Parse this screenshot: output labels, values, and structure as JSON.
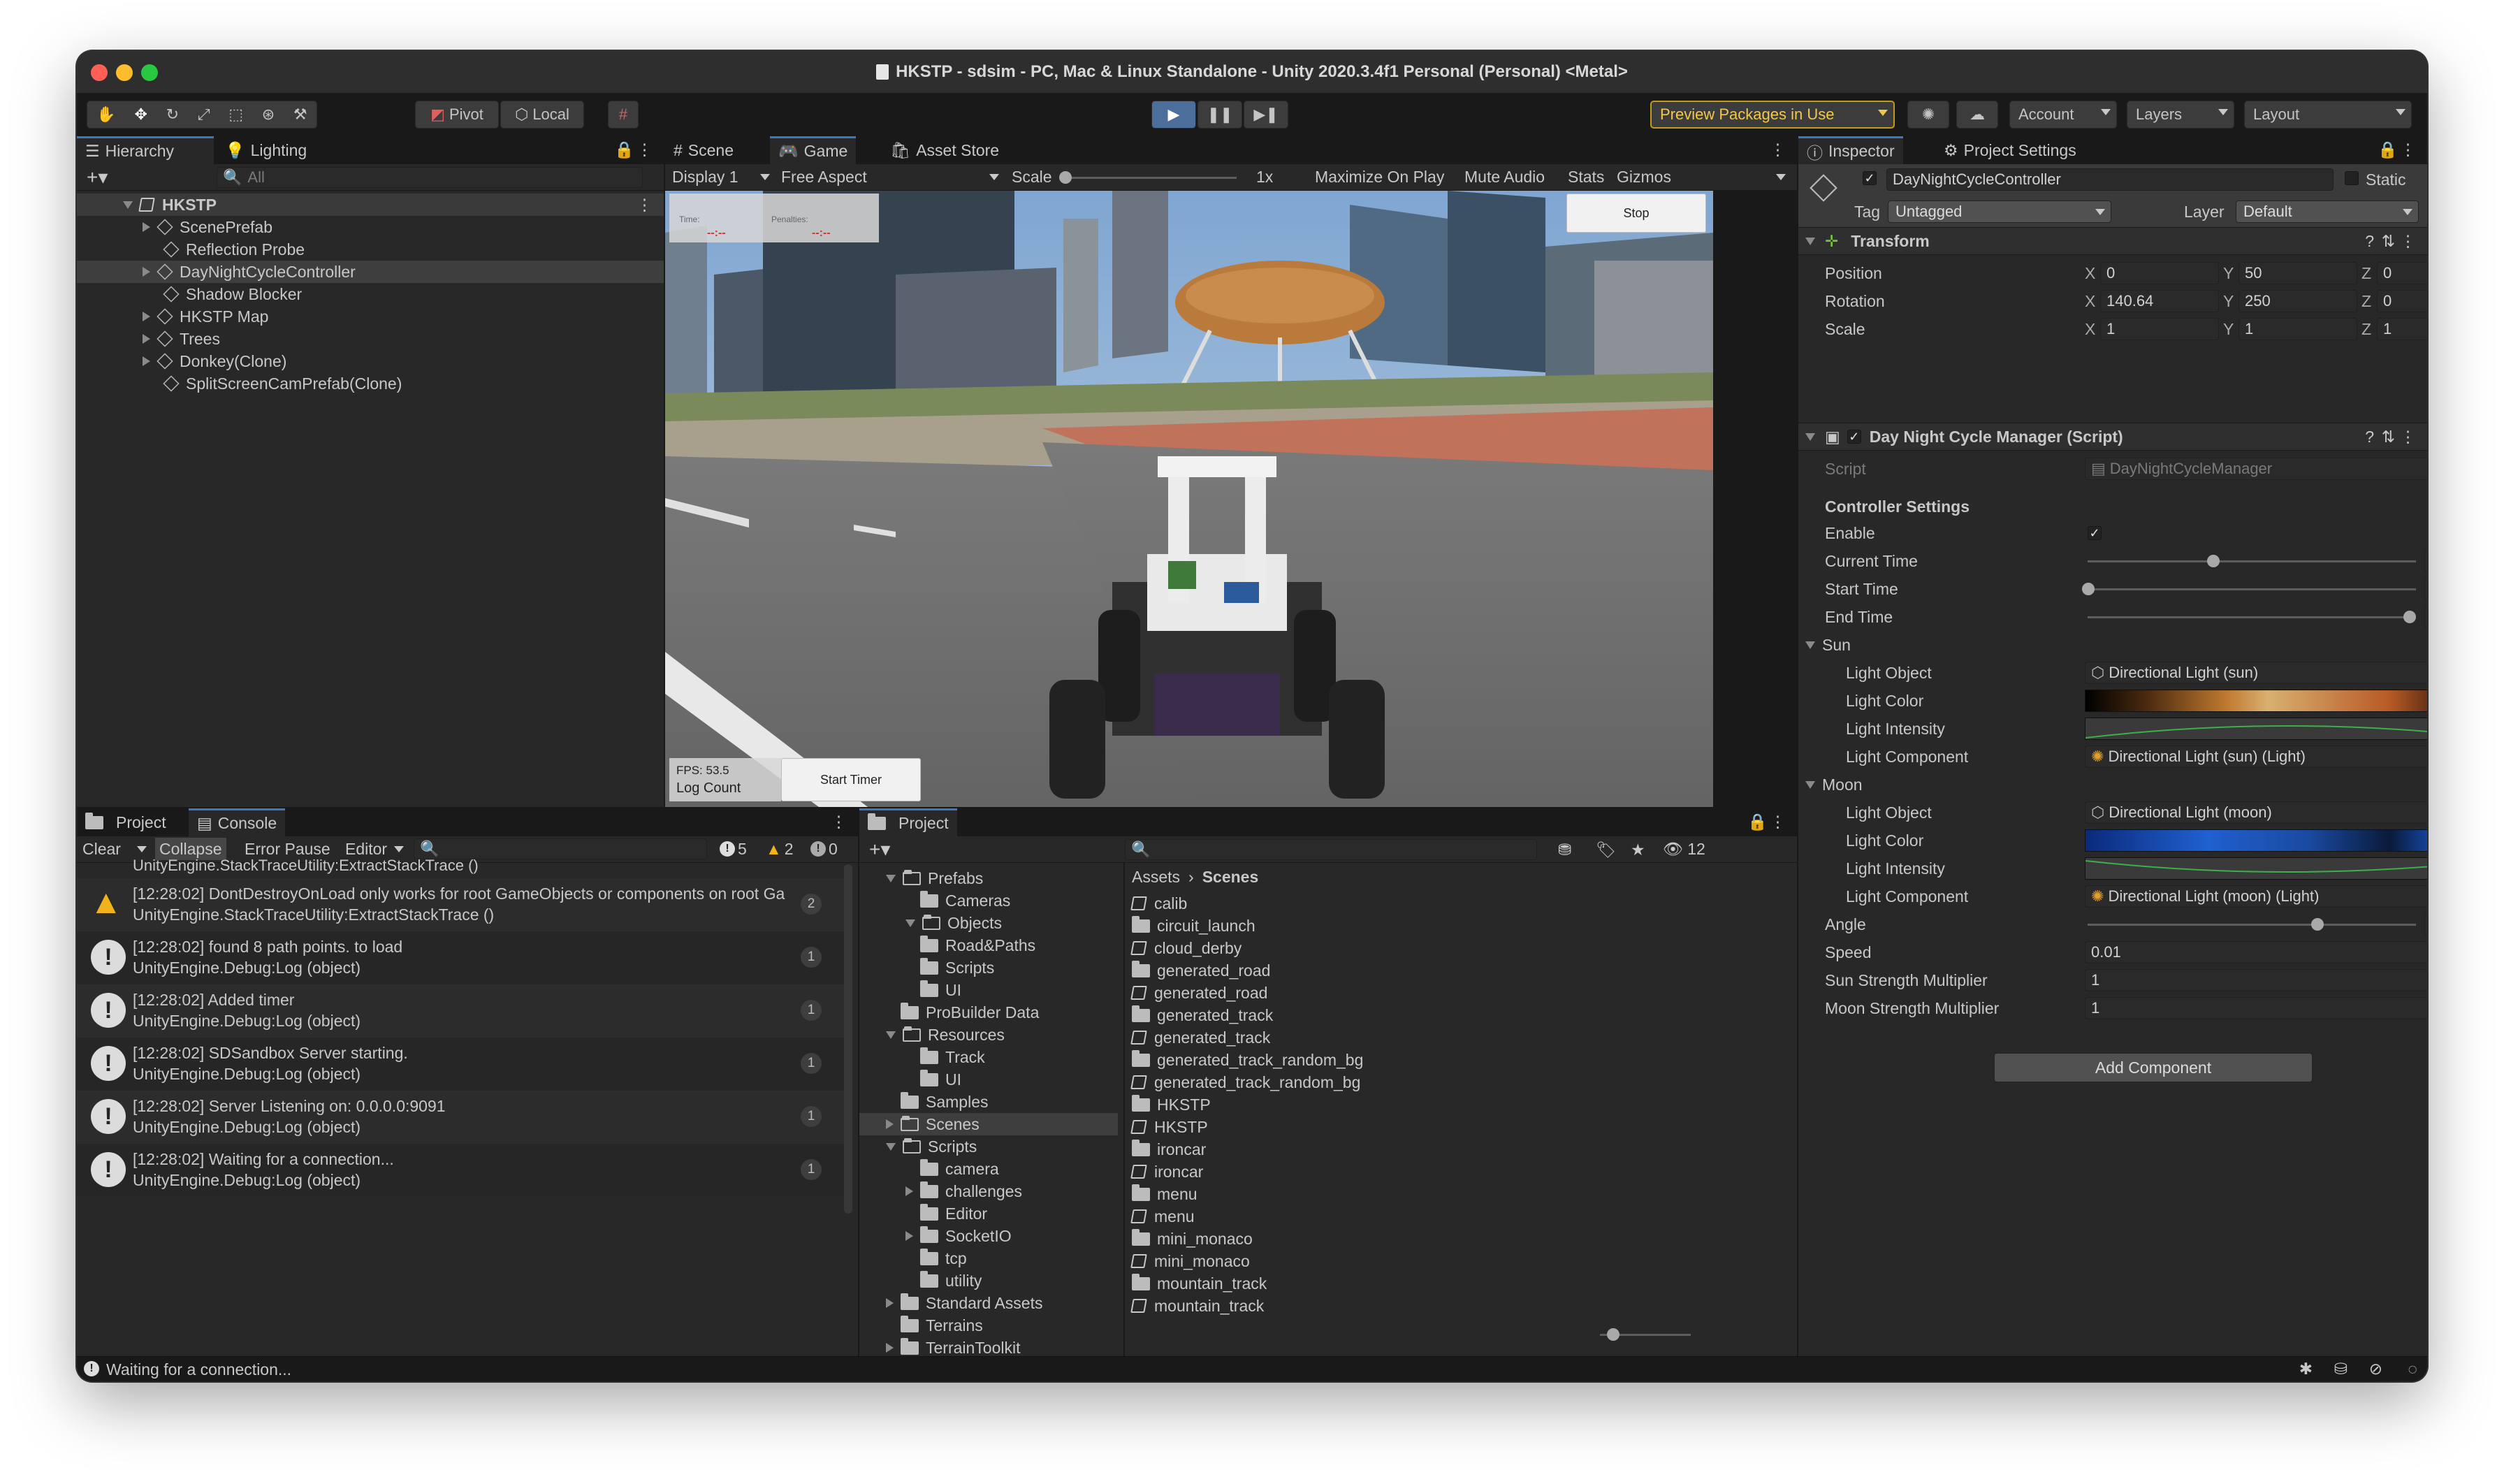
{
  "window": {
    "title": "HKSTP - sdsim - PC, Mac & Linux Standalone - Unity 2020.3.4f1 Personal (Personal) <Metal>"
  },
  "toolbar": {
    "pivot": "Pivot",
    "local": "Local",
    "preview_packages": "Preview Packages in Use",
    "account": "Account",
    "layers": "Layers",
    "layout": "Layout"
  },
  "hierarchy": {
    "tab": "Hierarchy",
    "lighting_tab": "Lighting",
    "search_placeholder": "All",
    "root": "HKSTP",
    "items": [
      "ScenePrefab",
      "Reflection Probe",
      "DayNightCycleController",
      "Shadow Blocker",
      "HKSTP Map",
      "Trees",
      "Donkey(Clone)",
      "SplitScreenCamPrefab(Clone)"
    ]
  },
  "gameview": {
    "tabs": [
      "Scene",
      "Game",
      "Asset Store"
    ],
    "display": "Display 1",
    "aspect": "Free Aspect",
    "scale_label": "Scale",
    "scale_value": "1x",
    "buttons": [
      "Maximize On Play",
      "Mute Audio",
      "Stats",
      "Gizmos"
    ],
    "overlay": {
      "time_label": "Time:",
      "time_value": "--:--",
      "penalties_label": "Penalties:",
      "penalties_value": "--:--",
      "stop": "Stop",
      "fps": "FPS: 53.5",
      "log_count": "Log Count",
      "start_timer": "Start Timer"
    }
  },
  "console": {
    "project_tab": "Project",
    "tab": "Console",
    "clear": "Clear",
    "collapse": "Collapse",
    "error_pause": "Error Pause",
    "editor": "Editor",
    "count_info": "5",
    "count_warn": "2",
    "count_err": "0",
    "cut_line": "UnityEngine.StackTraceUtility:ExtractStackTrace ()",
    "entries": [
      {
        "type": "warn",
        "l1": "[12:28:02] DontDestroyOnLoad only works for root GameObjects or components on root Ga",
        "l2": "UnityEngine.StackTraceUtility:ExtractStackTrace ()",
        "count": "2"
      },
      {
        "type": "info",
        "l1": "[12:28:02] found 8 path points. to load",
        "l2": "UnityEngine.Debug:Log (object)",
        "count": "1"
      },
      {
        "type": "info",
        "l1": "[12:28:02] Added timer",
        "l2": "UnityEngine.Debug:Log (object)",
        "count": "1"
      },
      {
        "type": "info",
        "l1": "[12:28:02] SDSandbox Server starting.",
        "l2": "UnityEngine.Debug:Log (object)",
        "count": "1"
      },
      {
        "type": "info",
        "l1": "[12:28:02] Server Listening on: 0.0.0.0:9091",
        "l2": "UnityEngine.Debug:Log (object)",
        "count": "1"
      },
      {
        "type": "info",
        "l1": "[12:28:02] Waiting for a connection...",
        "l2": "UnityEngine.Debug:Log (object)",
        "count": "1"
      }
    ]
  },
  "project": {
    "tab": "Project",
    "hidden_count": "12",
    "breadcrumb_root": "Assets",
    "breadcrumb_current": "Scenes",
    "tree": [
      "Prefabs",
      "Cameras",
      "Objects",
      "Road&Paths",
      "Scripts",
      "UI",
      "ProBuilder Data",
      "Resources",
      "Track",
      "UI",
      "Samples",
      "Scenes",
      "Scripts",
      "camera",
      "challenges",
      "Editor",
      "SocketIO",
      "tcp",
      "utility",
      "Standard Assets",
      "Terrains",
      "TerrainToolkit"
    ],
    "files": [
      {
        "name": "calib",
        "scene": true
      },
      {
        "name": "circuit_launch",
        "scene": false
      },
      {
        "name": "cloud_derby",
        "scene": true
      },
      {
        "name": "generated_road",
        "scene": false
      },
      {
        "name": "generated_road",
        "scene": true
      },
      {
        "name": "generated_track",
        "scene": false
      },
      {
        "name": "generated_track",
        "scene": true
      },
      {
        "name": "generated_track_random_bg",
        "scene": false
      },
      {
        "name": "generated_track_random_bg",
        "scene": true
      },
      {
        "name": "HKSTP",
        "scene": false
      },
      {
        "name": "HKSTP",
        "scene": true
      },
      {
        "name": "ironcar",
        "scene": false
      },
      {
        "name": "ironcar",
        "scene": true
      },
      {
        "name": "menu",
        "scene": false
      },
      {
        "name": "menu",
        "scene": true
      },
      {
        "name": "mini_monaco",
        "scene": false
      },
      {
        "name": "mini_monaco",
        "scene": true
      },
      {
        "name": "mountain_track",
        "scene": false
      },
      {
        "name": "mountain_track",
        "scene": true
      }
    ]
  },
  "inspector": {
    "tab": "Inspector",
    "settings_tab": "Project Settings",
    "object_name": "DayNightCycleController",
    "static": "Static",
    "tag_label": "Tag",
    "tag": "Untagged",
    "layer_label": "Layer",
    "layer": "Default",
    "transform": {
      "title": "Transform",
      "position": "Position",
      "rotation": "Rotation",
      "scale": "Scale",
      "pos": [
        "0",
        "50",
        "0"
      ],
      "rot": [
        "140.64",
        "250",
        "0"
      ],
      "scl": [
        "1",
        "1",
        "1"
      ]
    },
    "script_comp": {
      "title": "Day Night Cycle Manager (Script)",
      "script_label": "Script",
      "script": "DayNightCycleManager"
    },
    "controller_settings": "Controller Settings",
    "enable": "Enable",
    "current_time": "Current Time",
    "current_time_value": "9.37599",
    "start_time": "Start Time",
    "start_time_value": "0",
    "end_time": "End Time",
    "end_time_value": "24",
    "sun": "Sun",
    "moon": "Moon",
    "light_object": "Light Object",
    "light_color": "Light Color",
    "light_intensity": "Light Intensity",
    "light_component": "Light Component",
    "sun_object": "Directional Light (sun)",
    "sun_component": "Directional Light (sun) (Light)",
    "moon_object": "Directional Light (moon)",
    "moon_component": "Directional Light (moon) (Light)",
    "angle": "Angle",
    "angle_value": "250",
    "speed": "Speed",
    "speed_value": "0.01",
    "sun_mult": "Sun Strength Multiplier",
    "sun_mult_value": "1",
    "moon_mult": "Moon Strength Multiplier",
    "moon_mult_value": "1",
    "add_component": "Add Component"
  },
  "status": {
    "text": "Waiting for a connection..."
  }
}
